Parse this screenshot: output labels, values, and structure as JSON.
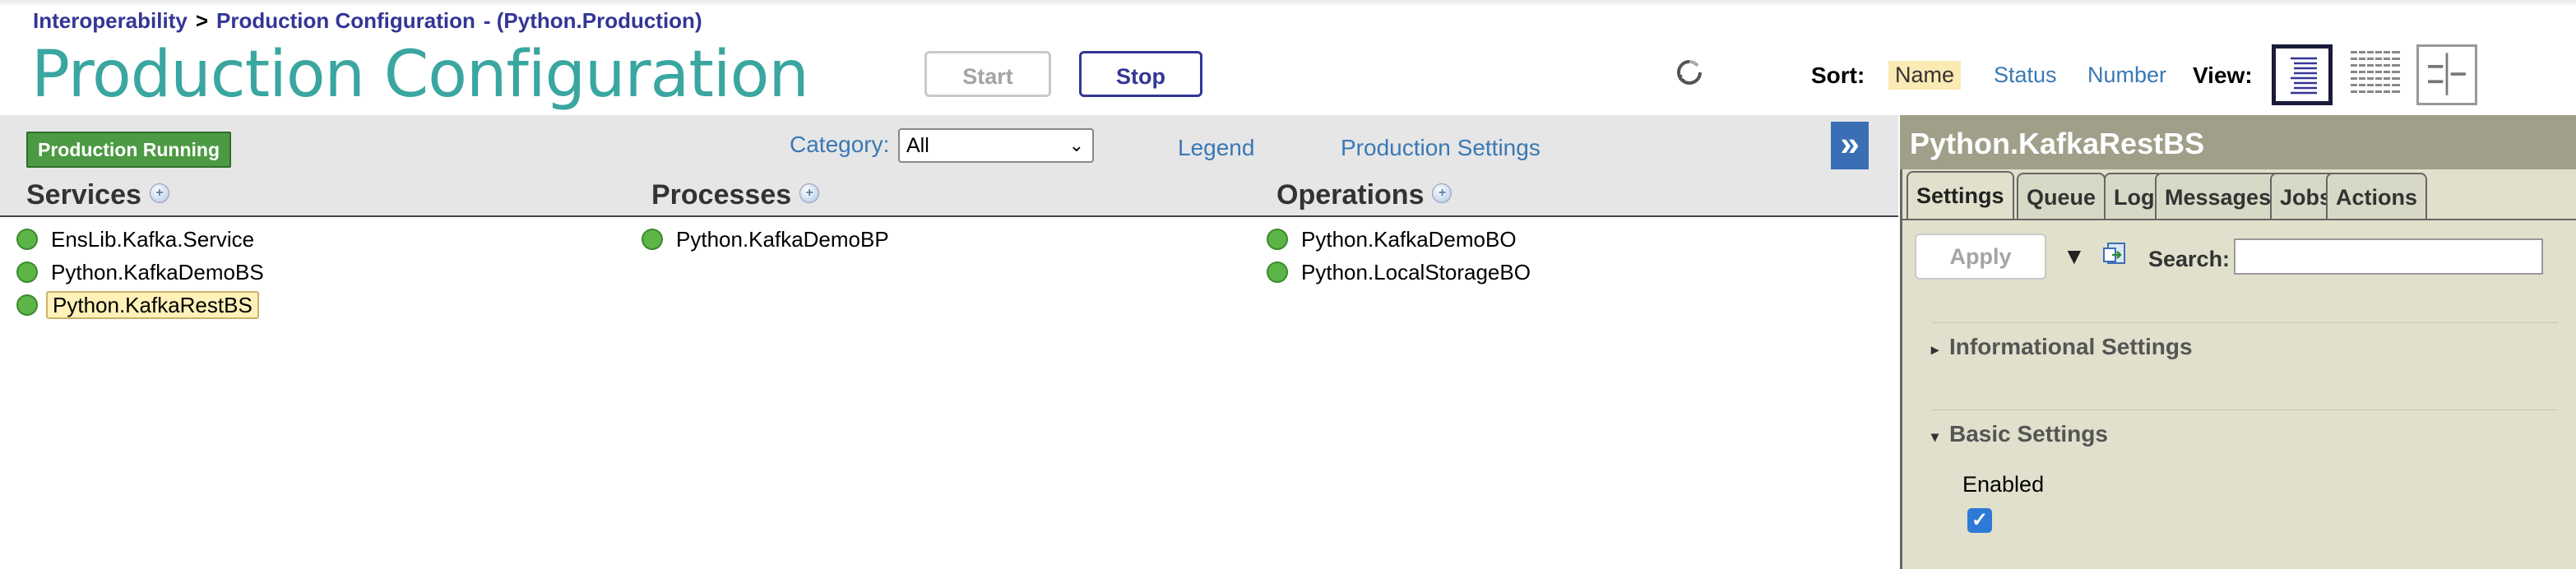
{
  "breadcrumb": {
    "root": "Interoperability",
    "separator": ">",
    "current": "Production Configuration",
    "namespace": "- (Python.Production)"
  },
  "page_title": "Production Configuration",
  "header_buttons": {
    "start": "Start",
    "stop": "Stop"
  },
  "sort": {
    "label": "Sort:",
    "options": [
      "Name",
      "Status",
      "Number"
    ],
    "selected": "Name"
  },
  "view": {
    "label": "View:",
    "icons": [
      "list-view-icon",
      "grid-view-icon",
      "split-view-icon"
    ],
    "selected": "list-view-icon"
  },
  "toolbar": {
    "status": "Production Running",
    "category_label": "Category:",
    "category_value": "All",
    "legend": "Legend",
    "production_settings": "Production Settings",
    "expand": "»"
  },
  "columns": {
    "services": {
      "title": "Services",
      "items": [
        "EnsLib.Kafka.Service",
        "Python.KafkaDemoBS",
        "Python.KafkaRestBS"
      ],
      "selected": "Python.KafkaRestBS"
    },
    "processes": {
      "title": "Processes",
      "items": [
        "Python.KafkaDemoBP"
      ]
    },
    "operations": {
      "title": "Operations",
      "items": [
        "Python.KafkaDemoBO",
        "Python.LocalStorageBO"
      ]
    }
  },
  "panel": {
    "title": "Python.KafkaRestBS",
    "tabs": [
      "Settings",
      "Queue",
      "Log",
      "Messages",
      "Jobs",
      "Actions"
    ],
    "active_tab": "Settings",
    "apply": "Apply",
    "search_label": "Search:",
    "search_value": "",
    "sections": [
      "Informational Settings",
      "Basic Settings"
    ],
    "enabled_label": "Enabled",
    "enabled": true
  },
  "colors": {
    "title": "#3aa6a0",
    "link": "#3a78b5",
    "navy": "#333695",
    "status_green": "#4c9a43"
  }
}
